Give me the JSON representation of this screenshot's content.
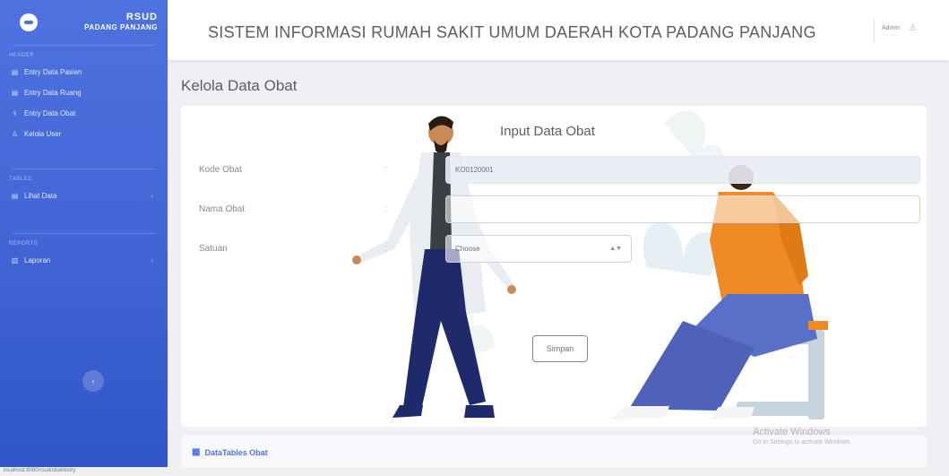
{
  "brand": {
    "title": "RSUD",
    "subtitle": "PADANG PANJANG"
  },
  "sidebar": {
    "heading_1": "Header",
    "items_1": [
      {
        "label": "Entry Data Pasien",
        "icon": "table-icon"
      },
      {
        "label": "Entry Data Ruang",
        "icon": "table-icon"
      },
      {
        "label": "Entry Data Obat",
        "icon": "pills-icon"
      },
      {
        "label": "Kelola User",
        "icon": "user-icon"
      }
    ],
    "heading_2": "Tables",
    "items_2": [
      {
        "label": "Lihat Data",
        "icon": "table-icon"
      }
    ],
    "heading_3": "Reports",
    "items_3": [
      {
        "label": "Laporan",
        "icon": "chart-icon"
      }
    ]
  },
  "topbar": {
    "title": "SISTEM INFORMASI RUMAH SAKIT UMUM DAERAH KOTA PADANG PANJANG",
    "user": "Admin"
  },
  "page": {
    "title": "Kelola Data Obat"
  },
  "form": {
    "title": "Input Data Obat",
    "kode_label": "Kode Obat",
    "kode_value": "KO0120001",
    "nama_label": "Nama Obat",
    "nama_value": "",
    "satuan_label": "Satuan",
    "satuan_value": "Choose",
    "colon": ":",
    "save_label": "Simpan"
  },
  "table_card": {
    "title": "DataTables Obat"
  },
  "overlay": {
    "activate_title": "Activate Windows",
    "activate_sub": "Go to Settings to activate Windows."
  },
  "status": {
    "text": "localhost:8080/rsud/obat/entry"
  },
  "colors": {
    "primary": "#4e73df",
    "orange": "#f08a24",
    "navy": "#1f2a6b"
  }
}
